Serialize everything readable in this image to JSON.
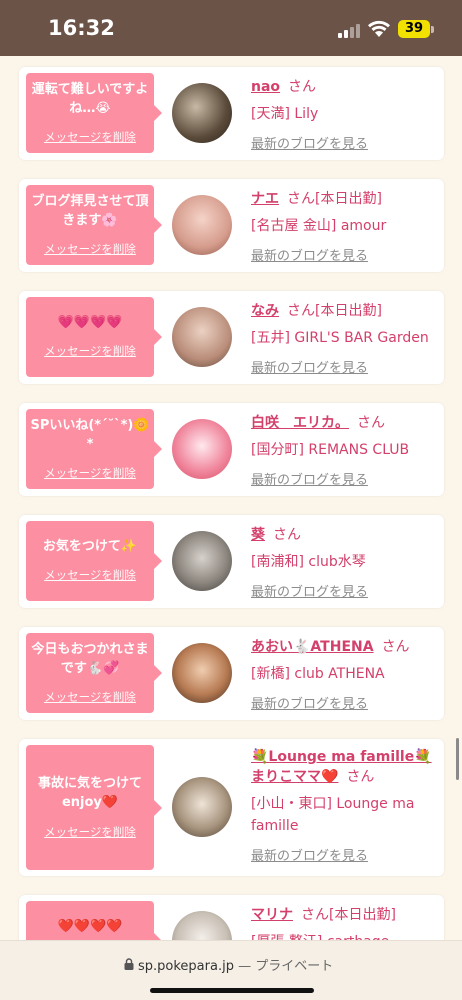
{
  "status_bar": {
    "time": "16:32",
    "battery": "39"
  },
  "common": {
    "delete_label": "メッセージを削除",
    "blog_label": "最新のブログを見る",
    "san": "さん"
  },
  "cards": [
    {
      "message": "運転て難しいですよね…😭",
      "name": "nao",
      "suffix": "",
      "shop": "[天満] Lily"
    },
    {
      "message": "ブログ拝見させて頂きます🌸",
      "name": "ナエ",
      "suffix": "[本日出勤]",
      "shop": "[名古屋 金山] amour"
    },
    {
      "message": "💗💗💗💗",
      "name": "なみ",
      "suffix": "[本日出勤]",
      "shop": "[五井] GIRL'S BAR Garden"
    },
    {
      "message": "SPいいね(*´˘`*)🌼*",
      "name": "白咲　エリカ。",
      "suffix": "",
      "shop": "[国分町] REMANS CLUB"
    },
    {
      "message": "お気をつけて✨",
      "name": "葵",
      "suffix": "",
      "shop": "[南浦和] club水琴"
    },
    {
      "message": "今日もおつかれさまです🐇💞",
      "name": "あおい🐇ATHENA",
      "suffix": "",
      "shop": "[新橋] club ATHENA"
    },
    {
      "message": "事故に気をつけてenjoy❤️",
      "name": "💐Lounge ma famille💐まりこママ❤️",
      "suffix": "",
      "shop": "[小山・東口] Lounge ma famille"
    },
    {
      "message": "❤️❤️❤️❤️",
      "name": "マリナ",
      "suffix": "[本日出勤]",
      "shop": "[厚張 整江] carthage"
    }
  ],
  "url_bar": {
    "domain": "sp.pokepara.jp",
    "mode": "— プライベート"
  }
}
